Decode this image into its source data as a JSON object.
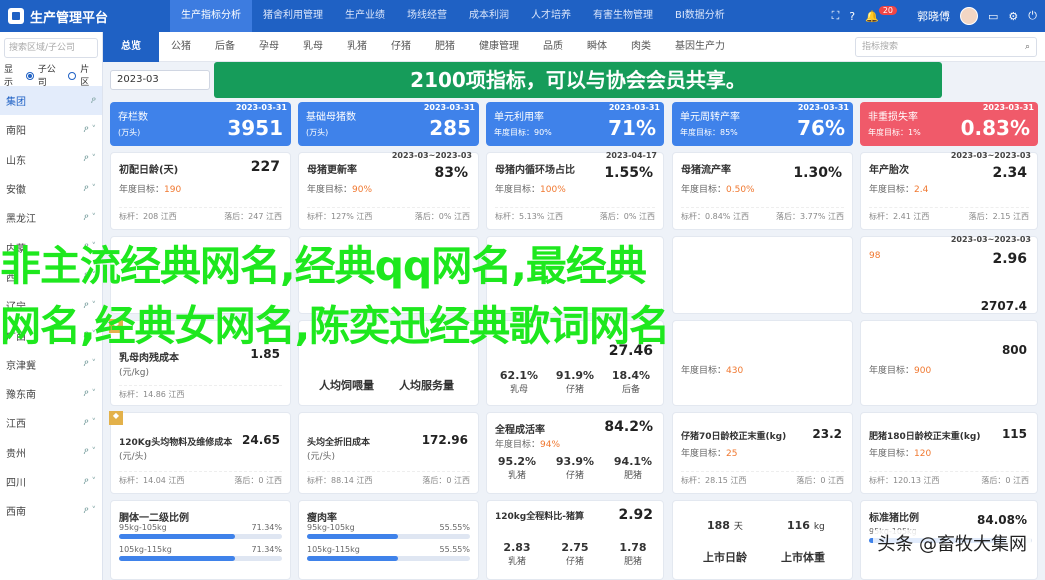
{
  "app": {
    "title": "生产管理平台"
  },
  "topnav": [
    "生产指标分析",
    "猪舍利用管理",
    "生产业绩",
    "场线经营",
    "成本利润",
    "人才培养",
    "有害生物管理",
    "BI数据分析"
  ],
  "user": {
    "name": "郭晓傅",
    "badge": "20"
  },
  "sidebar": {
    "search_placeholder": "搜索区域/子公司",
    "view_label": "显示",
    "opt1": "子公司",
    "opt2": "片区",
    "items": [
      "集团",
      "南阳",
      "山东",
      "安徽",
      "黑龙江",
      "内蒙",
      "西",
      "辽宁",
      "广西",
      "京津冀",
      "豫东南",
      "江西",
      "贵州",
      "四川",
      "西南"
    ]
  },
  "tabs": [
    "总览",
    "公猪",
    "后备",
    "孕母",
    "乳母",
    "乳猪",
    "仔猪",
    "肥猪",
    "健康管理",
    "品质",
    "瞬体",
    "肉类",
    "基因生产力"
  ],
  "tab_search_placeholder": "指标搜索",
  "date": "2023-03",
  "banner": "2100项指标，可以与协会会员共享。",
  "kpis": [
    {
      "name": "存栏数",
      "unit": "(万头)",
      "date": "2023-03-31",
      "value": "3951",
      "color": "#3f82ea",
      "sub": ""
    },
    {
      "name": "基础母猪数",
      "unit": "(万头)",
      "date": "2023-03-31",
      "value": "285",
      "color": "#3f82ea",
      "sub": ""
    },
    {
      "name": "单元利用率",
      "unit": "年度目标：90%",
      "date": "2023-03-31",
      "value": "71%",
      "color": "#3f82ea",
      "sub": ""
    },
    {
      "name": "单元周转产率",
      "unit": "年度目标：85%",
      "date": "2023-03-31",
      "value": "76%",
      "color": "#3f82ea",
      "sub": ""
    },
    {
      "name": "非重损失率",
      "unit": "年度目标：1%",
      "date": "2023-03-31",
      "value": "0.83%",
      "color": "#f05a6a",
      "sub": ""
    }
  ],
  "row1": [
    {
      "name": "初配日龄(天)",
      "value": "227",
      "target": "190",
      "foot1": "标杆：208 江西",
      "foot2": "落后：247 江西",
      "date": ""
    },
    {
      "name": "母猪更新率",
      "value": "83%",
      "target": "90%",
      "foot1": "标杆：127% 江西",
      "foot2": "落后：0% 江西",
      "date": "2023-03~2023-03"
    },
    {
      "name": "母猪内循环场占比",
      "value": "1.55%",
      "target": "100%",
      "foot1": "标杆：5.13% 江西",
      "foot2": "落后：0% 江西",
      "date": "2023-04-17"
    },
    {
      "name": "母猪流产率",
      "value": "1.30%",
      "target": "0.50%",
      "foot1": "标杆：0.84% 江西",
      "foot2": "落后：3.77% 江西",
      "date": ""
    },
    {
      "name": "年产胎次",
      "value": "2.34",
      "target": "2.4",
      "foot1": "标杆：2.41 江西",
      "foot2": "落后：2.15 江西",
      "date": "2023-03~2023-03"
    }
  ],
  "overlay": {
    "line1": "非主流经典网名,经典qq网名,最经典",
    "line2": "网名,经典女网名,陈奕迅经典歌词网名"
  },
  "row2_peek": {
    "r_date": "2023-03~2023-03",
    "r_val1": "2.96",
    "r_val2": "2707.4",
    "r_target": "98"
  },
  "row3": {
    "c1": {
      "name": "乳母肉残成本",
      "value": "1.85",
      "foot": "(元/kg)",
      "foot2": "标杆：14.86 江西"
    },
    "c2": {
      "a": "人均饲喂量",
      "b": "人均服务量"
    },
    "c3": {
      "value": "27.46",
      "m1": "62.1%",
      "m1l": "乳母",
      "m2": "91.9%",
      "m2l": "仔猪",
      "m3": "18.4%",
      "m3l": "后备"
    },
    "c4": {
      "target": "430"
    },
    "c5": {
      "target": "900",
      "value": "800"
    }
  },
  "row4": [
    {
      "name": "120Kg头均物料及维修成本",
      "value": "24.65",
      "unit": "(元/头)",
      "foot1": "标杆：14.04 江西",
      "foot2": "落后：0 江西"
    },
    {
      "name": "头均全折旧成本",
      "value": "172.96",
      "unit": "(元/头)",
      "foot1": "标杆：88.14 江西",
      "foot2": "落后：0 江西"
    },
    {
      "name": "全程成活率",
      "value": "84.2%",
      "target": "94%",
      "m1": "95.2%",
      "m1l": "乳猪",
      "m2": "93.9%",
      "m2l": "仔猪",
      "m3": "94.1%",
      "m3l": "肥猪"
    },
    {
      "name": "仔猪70日龄校正末重",
      "unit": "(kg)",
      "value": "23.2",
      "target": "25",
      "foot1": "标杆：28.15 江西",
      "foot2": "落后：0 江西"
    },
    {
      "name": "肥猪180日龄校正末重",
      "unit": "(kg)",
      "value": "115",
      "target": "120",
      "foot1": "标杆：120.13 江西",
      "foot2": "落后：0 江西"
    }
  ],
  "row5": [
    {
      "name": "胴体一二级比例",
      "value": "",
      "p1l": "95kg-105kg",
      "p1": "71.34%",
      "p2l": "105kg-115kg",
      "p2": "71.34%"
    },
    {
      "name": "瘦肉率",
      "value": "",
      "p1l": "95kg-105kg",
      "p1": "55.55%",
      "p2l": "105kg-115kg",
      "p2": "55.55%"
    },
    {
      "name": "120kg全程料比-猪算",
      "value": "2.92",
      "m1": "2.83",
      "m1l": "乳猪",
      "m2": "2.75",
      "m2l": "仔猪",
      "m3": "1.78",
      "m3l": "肥猪"
    },
    {
      "name": "",
      "a": "188",
      "al": "天",
      "b": "116",
      "bl": "kg",
      "c": "上市日龄",
      "d": "上市体重"
    },
    {
      "name": "标准猪比例",
      "value": "84.08%",
      "p1l": "95kg-105kg",
      "p1": "",
      "p2l": "",
      "p2": ""
    }
  ],
  "watermark": "头条 @畜牧大集网",
  "progress": {
    "carcass": 0.7134,
    "lean": 0.5555,
    "standard": 0.8408
  }
}
